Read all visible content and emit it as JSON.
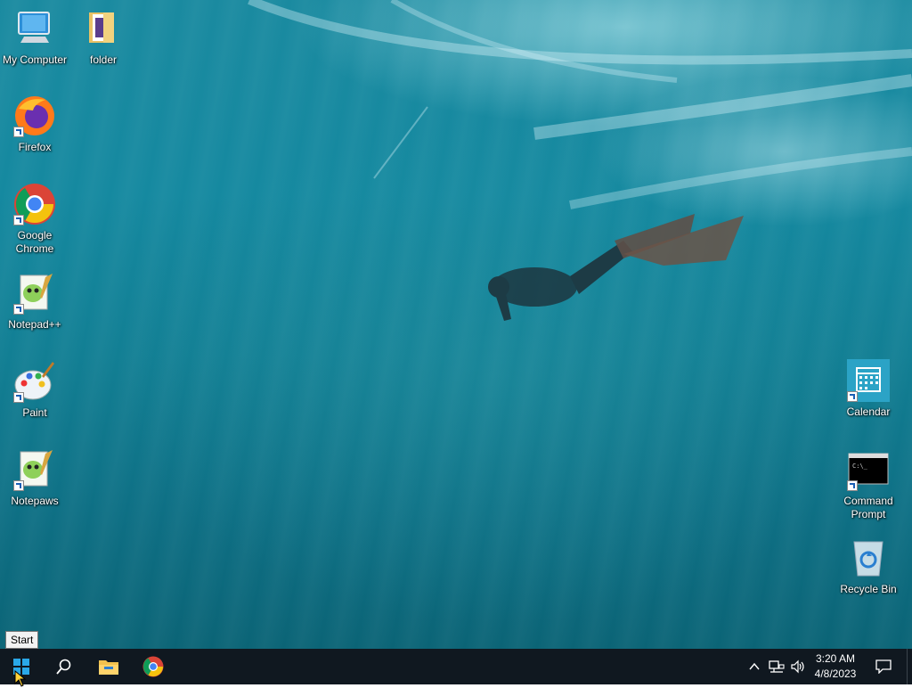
{
  "desktop": {
    "icons": {
      "my_computer": "My Computer",
      "folder": "folder",
      "firefox": "Firefox",
      "chrome": "Google Chrome",
      "notepadpp": "Notepad++",
      "paint": "Paint",
      "notepaws": "Notepaws",
      "calendar": "Calendar",
      "command_prompt": "Command Prompt",
      "recycle_bin": "Recycle Bin"
    }
  },
  "tooltip": {
    "text": "Start"
  },
  "taskbar": {
    "clock": {
      "time": "3:20 AM",
      "date": "4/8/2023"
    },
    "pinned": [
      "start-icon",
      "search-icon",
      "file-explorer-icon",
      "chrome-icon"
    ],
    "tray": [
      "chevron-up-icon",
      "network-icon",
      "volume-icon",
      "notification-icon"
    ]
  },
  "colors": {
    "taskbar": "#101820",
    "accent": "#1a8aa0"
  }
}
